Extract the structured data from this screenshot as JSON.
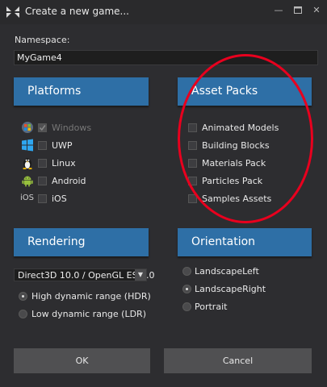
{
  "window": {
    "title": "Create a new game...",
    "minimize_icon": "minimize-icon",
    "maximize_icon": "maximize-icon",
    "close_icon": "close-icon"
  },
  "namespace": {
    "label": "Namespace:",
    "value": "MyGame4"
  },
  "platforms": {
    "header": "Platforms",
    "items": [
      {
        "label": "Windows",
        "icon": "windows-logo-icon",
        "checked": true,
        "disabled": true
      },
      {
        "label": "UWP",
        "icon": "windows-tiles-icon",
        "checked": false,
        "disabled": false
      },
      {
        "label": "Linux",
        "icon": "linux-tux-icon",
        "checked": false,
        "disabled": false
      },
      {
        "label": "Android",
        "icon": "android-icon",
        "checked": false,
        "disabled": false
      },
      {
        "label": "iOS",
        "icon_text": "iOS",
        "checked": false,
        "disabled": false
      }
    ]
  },
  "asset_packs": {
    "header": "Asset Packs",
    "items": [
      {
        "label": "Animated Models",
        "checked": false
      },
      {
        "label": "Building Blocks",
        "checked": false
      },
      {
        "label": "Materials Pack",
        "checked": false
      },
      {
        "label": "Particles Pack",
        "checked": false
      },
      {
        "label": "Samples Assets",
        "checked": false
      }
    ]
  },
  "rendering": {
    "header": "Rendering",
    "graphics_api": "Direct3D 10.0 / OpenGL ES 3.0",
    "options": [
      {
        "label": "High dynamic range (HDR)",
        "selected": true
      },
      {
        "label": "Low dynamic range (LDR)",
        "selected": false
      }
    ]
  },
  "orientation": {
    "header": "Orientation",
    "options": [
      {
        "label": "LandscapeLeft",
        "selected": false
      },
      {
        "label": "LandscapeRight",
        "selected": true
      },
      {
        "label": "Portrait",
        "selected": false
      }
    ]
  },
  "buttons": {
    "ok": "OK",
    "cancel": "Cancel"
  },
  "colors": {
    "section_header": "#2e6fa6",
    "annotation": "#e8001e",
    "background": "#2d2d30"
  }
}
